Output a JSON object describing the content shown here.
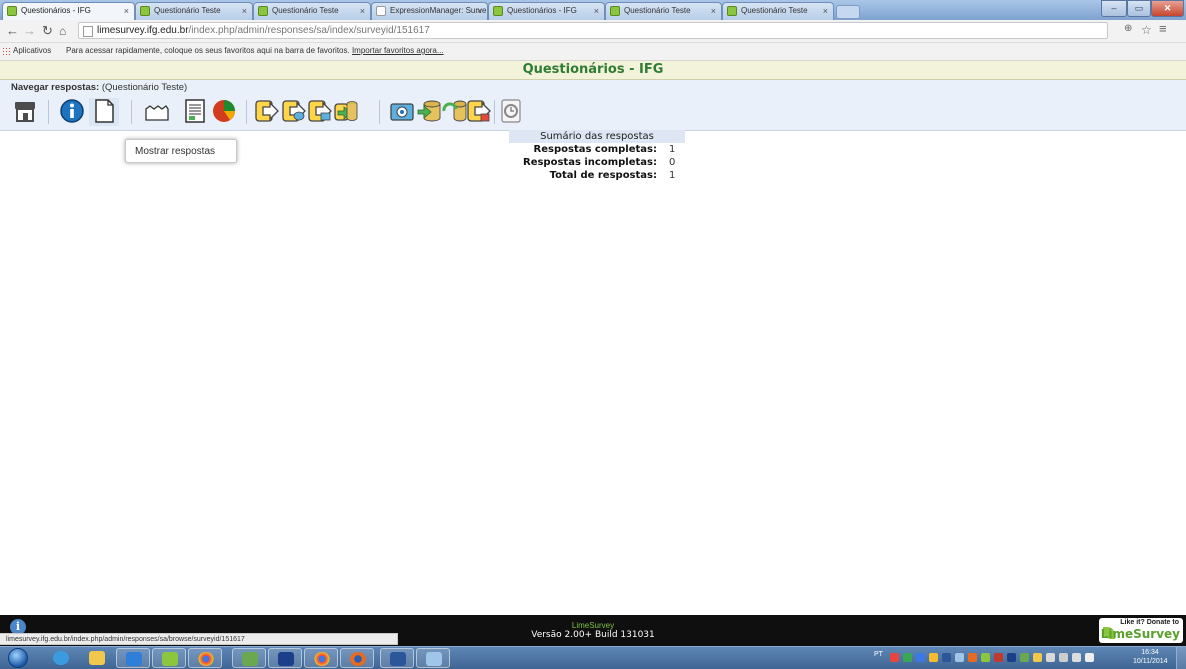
{
  "browser": {
    "tabs": [
      {
        "title": "Questionários - IFG",
        "active": true
      },
      {
        "title": "Questionário Teste",
        "active": false
      },
      {
        "title": "Questionário Teste",
        "active": false
      },
      {
        "title": "ExpressionManager: Surve",
        "active": false
      },
      {
        "title": "Questionários - IFG",
        "active": false
      },
      {
        "title": "Questionário Teste",
        "active": false
      },
      {
        "title": "Questionário Teste",
        "active": false
      }
    ],
    "url_host": "limesurvey.ifg.edu.br",
    "url_path": "/index.php/admin/responses/sa/index/surveyid/151617",
    "bookmarks": {
      "apps_label": "Aplicativos",
      "hint": "Para acessar rapidamente, coloque os seus favoritos aqui na barra de favoritos.",
      "import_link": "Importar favoritos agora..."
    }
  },
  "page": {
    "header_title": "Questionários - IFG",
    "browse_label": "Navegar respostas:",
    "survey_name": "(Questionário Teste)",
    "tooltip": "Mostrar respostas"
  },
  "summary": {
    "title": "Sumário das respostas",
    "rows": [
      {
        "label": "Respostas completas:",
        "value": "1"
      },
      {
        "label": "Respostas incompletas:",
        "value": "0"
      },
      {
        "label": "Total de respostas:",
        "value": "1"
      }
    ]
  },
  "footer": {
    "brand": "LimeSurvey",
    "version": "Versão 2.00+ Build 131031",
    "donate_line1": "Like it? Donate to",
    "donate_line2": "LimeSurvey",
    "status_url": "limesurvey.ifg.edu.br/index.php/admin/responses/sa/browse/surveyid/151617"
  },
  "taskbar": {
    "language": "PT",
    "time": "16:34",
    "date": "10/11/2014"
  },
  "colors": {
    "header_text": "#2e7d32",
    "browse_bar": "#e9f0fa",
    "footer_bg": "#0f0f0f"
  }
}
